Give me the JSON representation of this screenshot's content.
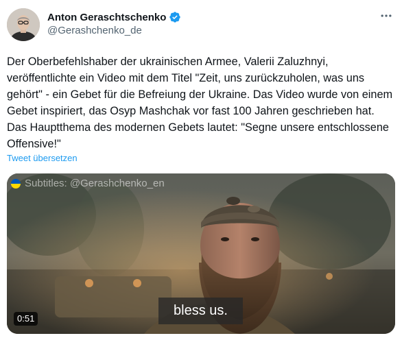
{
  "author": {
    "display_name": "Anton Geraschtschenko",
    "handle": "@Gerashchenko_de",
    "verified_color": "#1d9bf0"
  },
  "header": {
    "more_icon": "more-horizontal-icon"
  },
  "tweet": {
    "text": "Der Oberbefehlshaber der ukrainischen Armee, Valerii Zaluzhnyi, veröffentlichte ein Video mit dem Titel \"Zeit, uns zurückzuholen, was uns gehört\" - ein Gebet für die Befreiung der Ukraine. Das Video wurde von einem Gebet inspiriert, das Osyp Mashchak vor fast 100 Jahren geschrieben hat. Das Hauptthema des modernen Gebets lautet: \"Segne unsere entschlossene Offensive!\"",
    "translate_label": "Tweet übersetzen",
    "link_color": "#1d9bf0"
  },
  "video": {
    "watermark": "Subtitles: @Gerashchenko_en",
    "caption": "bless us.",
    "duration": "0:51"
  }
}
